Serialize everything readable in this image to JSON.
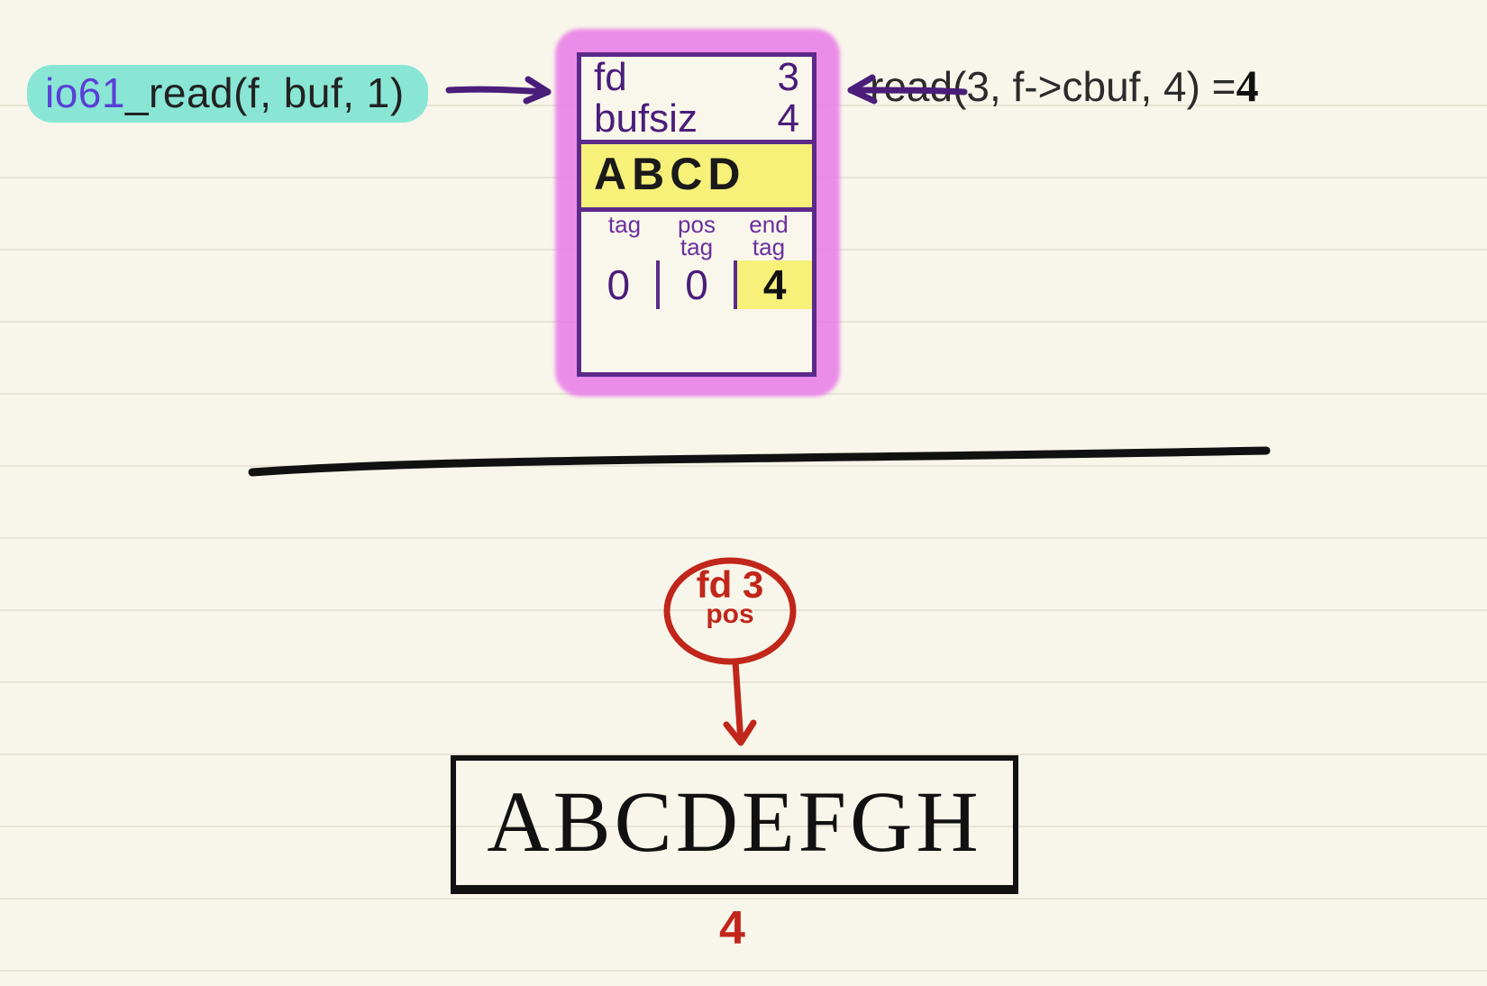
{
  "callsite": {
    "fn": "io61",
    "rest": "_read(f, buf, 1)"
  },
  "syscall": {
    "text": "read(3, f->cbuf, 4)",
    "ret_eq": " =",
    "ret_val": "4"
  },
  "struct": {
    "fd_label": "fd",
    "fd_val": "3",
    "bufsiz_label": "bufsiz",
    "bufsiz_val": "4",
    "cbuf_contents": "ABCD",
    "col_labels": [
      "tag",
      "pos\ntag",
      "end\ntag"
    ],
    "col_vals": [
      "0",
      "0",
      "4"
    ],
    "highlight_col": 2
  },
  "fdpos": {
    "line1": "fd 3",
    "line2": "pos"
  },
  "file": {
    "contents": "ABCDEFGH",
    "pos_index": "4"
  }
}
